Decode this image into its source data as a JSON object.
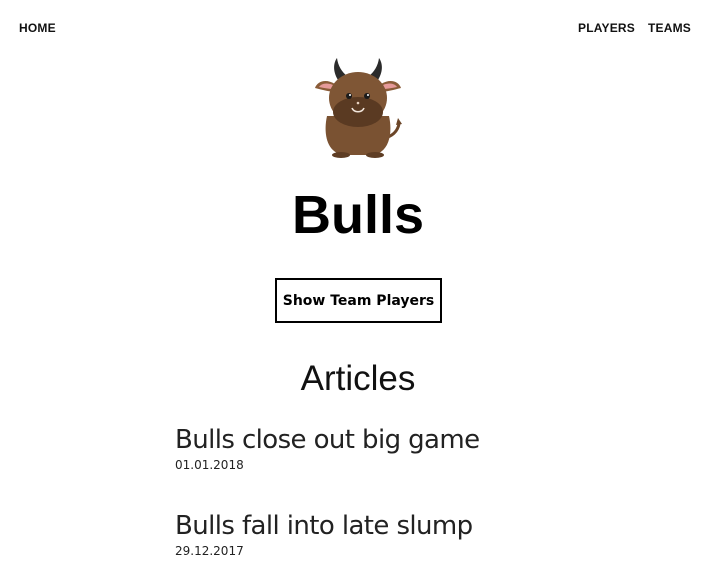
{
  "nav": {
    "home": "HOME",
    "players": "PLAYERS",
    "teams": "TEAMS"
  },
  "team": {
    "name": "Bulls",
    "logo_icon": "bull-mascot-icon"
  },
  "show_players_button": "Show Team Players",
  "articles": {
    "heading": "Articles",
    "items": [
      {
        "title": "Bulls close out big game",
        "date": "01.01.2018"
      },
      {
        "title": "Bulls fall into late slump",
        "date": "29.12.2017"
      }
    ]
  },
  "colors": {
    "background": "#ffffff",
    "text": "#000000",
    "bull_body": "#7a5232",
    "bull_snout": "#5a3a22",
    "bull_ear": "#e69a9a",
    "bull_horn": "#2b2b2b"
  }
}
